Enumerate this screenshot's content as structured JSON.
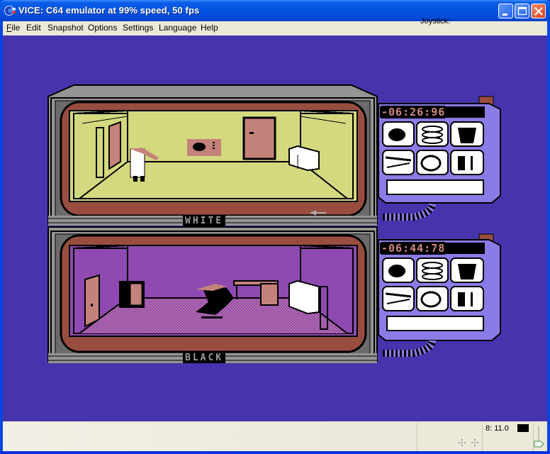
{
  "window": {
    "title": "VICE: C64 emulator at 99% speed, 50 fps",
    "icon": "commodore-logo-icon",
    "controls": {
      "minimize": "minimize-icon",
      "maximize": "maximize-icon",
      "close": "close-icon"
    }
  },
  "menu": {
    "items": [
      {
        "label": "File",
        "accel": "F"
      },
      {
        "label": "Edit",
        "accel": "E"
      },
      {
        "label": "Snapshot",
        "accel": "n"
      },
      {
        "label": "Options",
        "accel": "O"
      },
      {
        "label": "Settings",
        "accel": "t"
      },
      {
        "label": "Language",
        "accel": "L"
      },
      {
        "label": "Help",
        "accel": "H"
      }
    ]
  },
  "game": {
    "colors": {
      "background": "#4634ad",
      "tv_frame": "#959595",
      "tv_inner": "#994d3f",
      "white_room_wall": "#d4d980",
      "black_room_wall": "#8e4ab1",
      "panel": "#8a7ce6",
      "timer_text": "#d08a7c"
    },
    "players": [
      {
        "name": "WHITE",
        "timer": "-06:26:96",
        "inventory_icons": [
          "bomb-icon",
          "spring-icon",
          "bucket-icon",
          "gun-icon",
          "timebomb-icon",
          "map-icon"
        ],
        "direction_arrow": "arrow-left-icon"
      },
      {
        "name": "BLACK",
        "timer": "-06:44:78",
        "inventory_icons": [
          "bomb-icon",
          "spring-icon",
          "bucket-icon",
          "gun-icon",
          "timebomb-icon",
          "map-icon"
        ]
      }
    ]
  },
  "status": {
    "joystick_label": "Joystick:",
    "drive_status": "8: 11.0",
    "drive_led_color": "#000000"
  }
}
